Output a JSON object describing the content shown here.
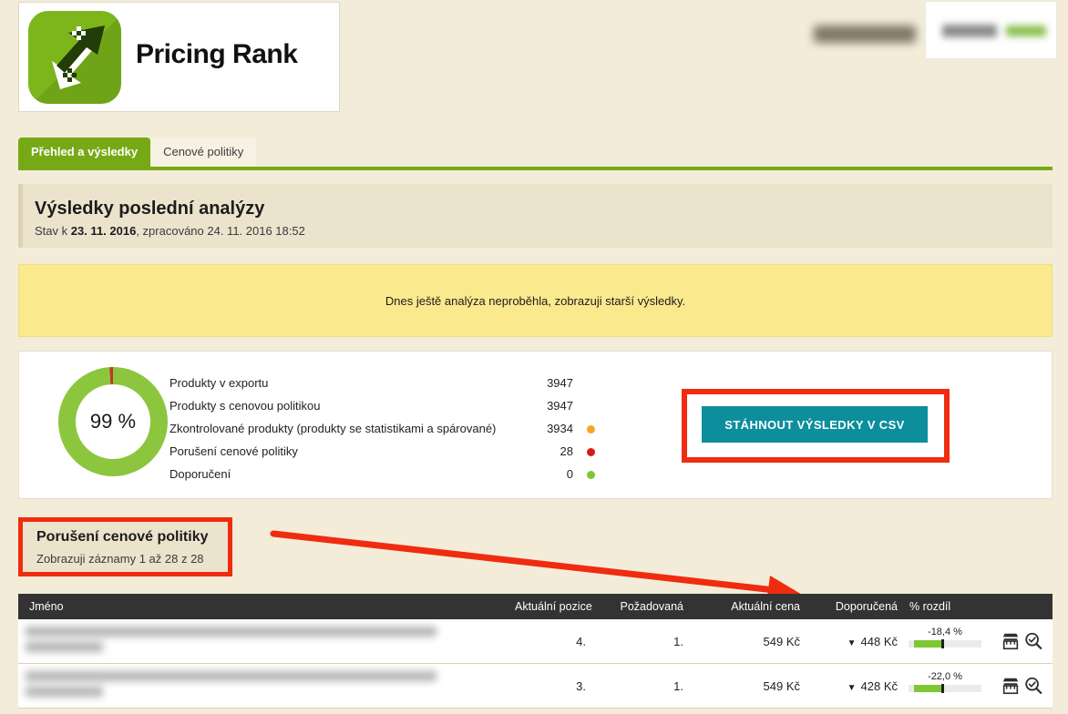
{
  "header": {
    "app_title": "Pricing Rank",
    "logo_icon": "dual-arrow-icon",
    "logo_bg": "#7db61b",
    "account_label_redacted": true,
    "brand_box_redacted": true
  },
  "tabs": [
    {
      "label": "Přehled a výsledky",
      "active": true
    },
    {
      "label": "Cenové politiky",
      "active": false
    }
  ],
  "results": {
    "title": "Výsledky poslední analýzy",
    "state_prefix": "Stav k ",
    "state_date": "23. 11. 2016",
    "state_suffix": ", zpracováno 24. 11. 2016 18:52"
  },
  "notice": {
    "text": "Dnes ještě analýza neproběhla, zobrazuji starší výsledky.",
    "bg": "#fbe98e"
  },
  "stats": {
    "donut_value": "99 %",
    "donut_percent": 99,
    "donut_color": "#8cc63e",
    "donut_remainder_color": "#c0392b",
    "rows": [
      {
        "label": "Produkty v exportu",
        "value": "3947",
        "dot": ""
      },
      {
        "label": "Produkty s cenovou politikou",
        "value": "3947",
        "dot": ""
      },
      {
        "label": "Zkontrolované produkty (produkty se statistikami a spárované)",
        "value": "3934",
        "dot": "#f5a623"
      },
      {
        "label": "Porušení cenové politiky",
        "value": "28",
        "dot": "#d81c13"
      },
      {
        "label": "Doporučení",
        "value": "0",
        "dot": "#7dc832"
      }
    ]
  },
  "csv": {
    "button_label": "STÁHNOUT VÝSLEDKY V CSV",
    "button_color": "#0d8e9c",
    "annotation_color": "#ef2c10"
  },
  "violations": {
    "title": "Porušení cenové politiky",
    "subtitle": "Zobrazuji záznamy 1 až 28 z 28",
    "annotation_color": "#ef2c10"
  },
  "table": {
    "columns": [
      {
        "key": "name",
        "label": "Jméno"
      },
      {
        "key": "current_position",
        "label": "Aktuální pozice"
      },
      {
        "key": "required",
        "label": "Požadovaná"
      },
      {
        "key": "current_price",
        "label": "Aktuální cena"
      },
      {
        "key": "recommended",
        "label": "Doporučená"
      },
      {
        "key": "difference",
        "label": "% rozdíl"
      }
    ],
    "rows": [
      {
        "name_redacted": true,
        "current_position": "4.",
        "required": "1.",
        "current_price": "549 Kč",
        "recommended_arrow": "▼",
        "recommended": "448 Kč",
        "difference": "-18,4 %",
        "difference_fill_pct": 38,
        "actions": [
          "shop-icon",
          "magnifier-check-icon"
        ]
      },
      {
        "name_redacted": true,
        "current_position": "3.",
        "required": "1.",
        "current_price": "549 Kč",
        "recommended_arrow": "▼",
        "recommended": "428 Kč",
        "difference": "-22,0 %",
        "difference_fill_pct": 38,
        "actions": [
          "shop-icon",
          "magnifier-check-icon"
        ]
      }
    ]
  },
  "annotations": {
    "arrow_color": "#ef2c10",
    "arrow_name": "red-pointer-arrow"
  }
}
